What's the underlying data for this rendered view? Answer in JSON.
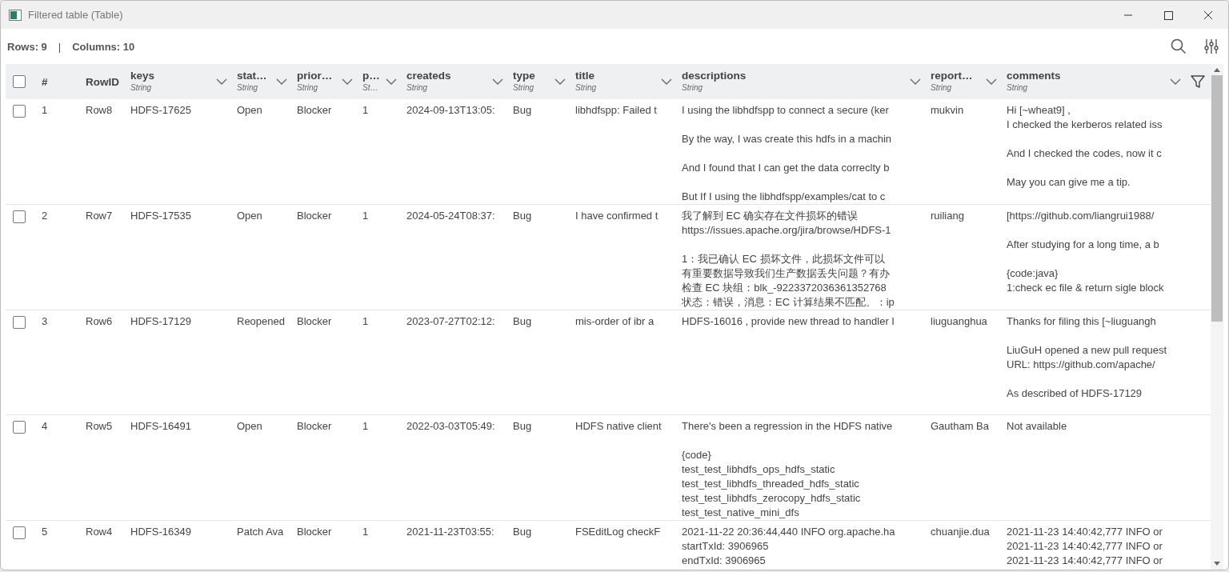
{
  "window": {
    "title": "Filtered table (Table)"
  },
  "toolbar": {
    "rows_label": "Rows: 9",
    "separator": "|",
    "columns_label": "Columns: 10"
  },
  "table": {
    "select_all": {
      "checked": false
    },
    "index_header": "#",
    "rowid_header": "RowID",
    "columns": [
      {
        "name": "keys",
        "type": "String"
      },
      {
        "name": "stat…",
        "type": "String"
      },
      {
        "name": "prior…",
        "type": "String"
      },
      {
        "name": "p…",
        "type": "St…"
      },
      {
        "name": "createds",
        "type": "String"
      },
      {
        "name": "type",
        "type": "String"
      },
      {
        "name": "title",
        "type": "String"
      },
      {
        "name": "descriptions",
        "type": "String"
      },
      {
        "name": "report…",
        "type": "String"
      },
      {
        "name": "comments",
        "type": "String"
      }
    ],
    "rows": [
      {
        "checked": false,
        "index": "1",
        "row_id": "Row8",
        "cells": [
          "HDFS-17625",
          "Open",
          "Blocker",
          "1",
          "2024-09-13T13:05:",
          "Bug",
          "libhdfspp: Failed t",
          [
            [
              "I using the libhdfspp to connect a secure (ker"
            ],
            [
              "By the way, I was create this hdfs in a machin"
            ],
            [
              "And I found that I can get the data correclty b"
            ],
            [
              "But If I using the libhdfspp/examples/cat to c"
            ]
          ],
          "mukvin",
          [
            [
              "Hi [~wheat9] ,",
              "I checked the kerberos related iss"
            ],
            [
              "And I checked the codes, now it c"
            ],
            [
              "May you can give me a tip."
            ]
          ]
        ]
      },
      {
        "checked": false,
        "index": "2",
        "row_id": "Row7",
        "cells": [
          "HDFS-17535",
          "Open",
          "Blocker",
          "1",
          "2024-05-24T08:37:",
          "Bug",
          "I have confirmed t",
          [
            [
              "我了解到 EC 确实存在文件损坏的错误",
              "https://issues.apache.org/jira/browse/HDFS-1"
            ],
            [
              "1：我已确认 EC 损坏文件，此损坏文件可以",
              "有重要数据导致我们生产数据丢失问题？有办",
              "检查 EC 块组：blk_-9223372036361352768",
              "状态：错误，消息：EC 计算结果不匹配。：ip"
            ]
          ],
          "ruiliang",
          [
            [
              "[https://github.com/liangrui1988/"
            ],
            [
              "After studying for a long time, a b"
            ],
            [
              "{code:java}",
              "1:check ec file & return sigle block"
            ]
          ]
        ]
      },
      {
        "checked": false,
        "index": "3",
        "row_id": "Row6",
        "cells": [
          "HDFS-17129",
          "Reopened",
          "Blocker",
          "1",
          "2023-07-27T02:12:",
          "Bug",
          "mis-order of ibr a",
          [
            [
              "HDFS-16016 , provide new thread to handler I"
            ]
          ],
          "liuguanghua",
          [
            [
              "Thanks for filing this [~liuguangh"
            ],
            [
              "LiuGuH opened a new pull request",
              "URL: https://github.com/apache/"
            ],
            [
              "As described of HDFS-17129"
            ]
          ]
        ]
      },
      {
        "checked": false,
        "index": "4",
        "row_id": "Row5",
        "cells": [
          "HDFS-16491",
          "Open",
          "Blocker",
          "1",
          "2022-03-03T05:49:",
          "Bug",
          "HDFS native client",
          [
            [
              "There's been a regression in the HDFS native"
            ],
            [
              "{code}",
              "test_test_libhdfs_ops_hdfs_static",
              "test_test_libhdfs_threaded_hdfs_static",
              "test_test_libhdfs_zerocopy_hdfs_static",
              "test_test_native_mini_dfs"
            ]
          ],
          "Gautham Ba",
          "Not available"
        ]
      },
      {
        "checked": false,
        "index": "5",
        "row_id": "Row4",
        "cells": [
          "HDFS-16349",
          "Patch Ava",
          "Blocker",
          "1",
          "2021-11-23T03:55:",
          "Bug",
          "FSEditLog checkF",
          [
            [
              "2021-11-22 20:36:44,440 INFO org.apache.ha",
              "startTxId: 3906965",
              "endTxId: 3906965"
            ]
          ],
          "chuanjie.dua",
          [
            [
              "2021-11-23 14:40:42,777 INFO or",
              "2021-11-23 14:40:42,777 INFO or",
              "2021-11-23 14:40:42,777 INFO or"
            ]
          ]
        ]
      }
    ]
  }
}
